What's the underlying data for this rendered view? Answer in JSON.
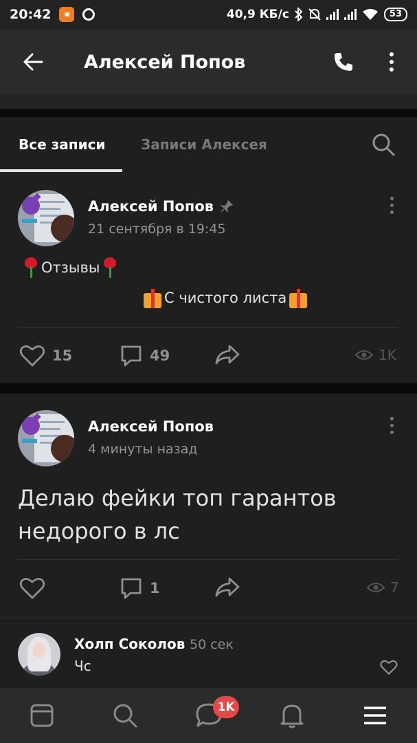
{
  "status_bar": {
    "time": "20:42",
    "speed": "40,9 КБ/с",
    "battery": "53"
  },
  "header": {
    "title": "Алексей Попов"
  },
  "tabs": [
    {
      "label": "Все записи",
      "active": true
    },
    {
      "label": "Записи Алексея",
      "active": false
    }
  ],
  "posts": [
    {
      "author": "Алексей Попов",
      "date": "21 сентября в 19:45",
      "pinned": true,
      "lines": [
        "Отзывы",
        "С чистого листа"
      ],
      "likes": "15",
      "comments": "49",
      "views": "1K"
    },
    {
      "author": "Алексей Попов",
      "date": "4 минуты назад",
      "pinned": false,
      "text": "Делаю фейки топ гарантов недорого в лс",
      "likes": "",
      "comments": "1",
      "views": "7"
    }
  ],
  "comment": {
    "author": "Холп Соколов",
    "time": "50 сек",
    "text": "Чс"
  },
  "bottom_nav": {
    "messages_badge": "1K"
  },
  "colors": {
    "background": "#0a0a0a",
    "surface": "#1f1f1f",
    "header": "#2b2b2b",
    "text": "#e1e3e6",
    "secondary": "#939393",
    "badge": "#e64646"
  }
}
